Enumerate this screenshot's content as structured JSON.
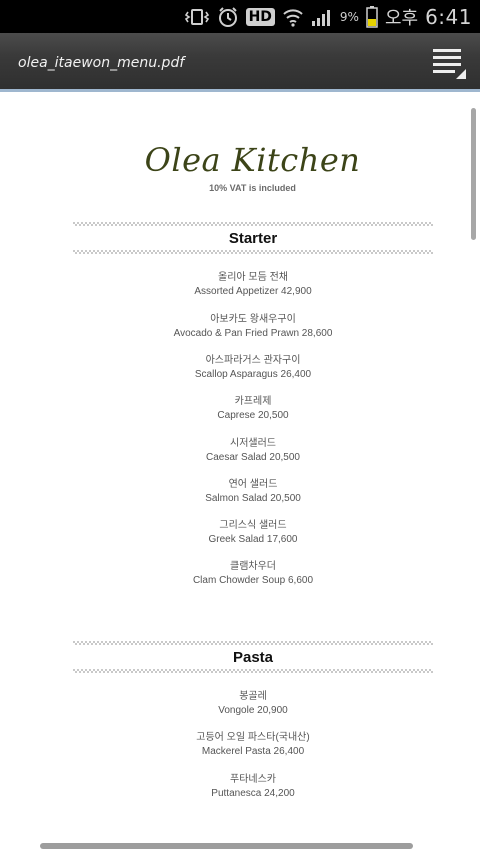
{
  "status_bar": {
    "battery_percent": "9%",
    "ampm": "오후",
    "time": "6:41",
    "hd_label": "HD"
  },
  "header": {
    "document_title": "olea_itaewon_menu.pdf"
  },
  "menu_doc": {
    "restaurant_name": "Olea Kitchen",
    "vat_note": "10% VAT is included",
    "sections": [
      {
        "title": "Starter",
        "items": [
          {
            "ko": "올리아 모듬 전채",
            "en": "Assorted Appetizer 42,900"
          },
          {
            "ko": "아보카도 왕새우구이",
            "en": "Avocado & Pan Fried Prawn 28,600"
          },
          {
            "ko": "아스파라거스 관자구이",
            "en": "Scallop Asparagus 26,400"
          },
          {
            "ko": "카프레제",
            "en": "Caprese 20,500"
          },
          {
            "ko": "시저샐러드",
            "en": "Caesar Salad 20,500"
          },
          {
            "ko": "연어 샐러드",
            "en": "Salmon Salad 20,500"
          },
          {
            "ko": "그리스식 샐러드",
            "en": "Greek Salad 17,600"
          },
          {
            "ko": "클램차우더",
            "en": "Clam Chowder Soup 6,600"
          }
        ]
      },
      {
        "title": "Pasta",
        "items": [
          {
            "ko": "봉골레",
            "en": "Vongole 20,900"
          },
          {
            "ko": "고등어 오일 파스타(국내산)",
            "en": "Mackerel Pasta 26,400"
          },
          {
            "ko": "푸타네스카",
            "en": "Puttanesca 24,200"
          }
        ]
      }
    ]
  }
}
